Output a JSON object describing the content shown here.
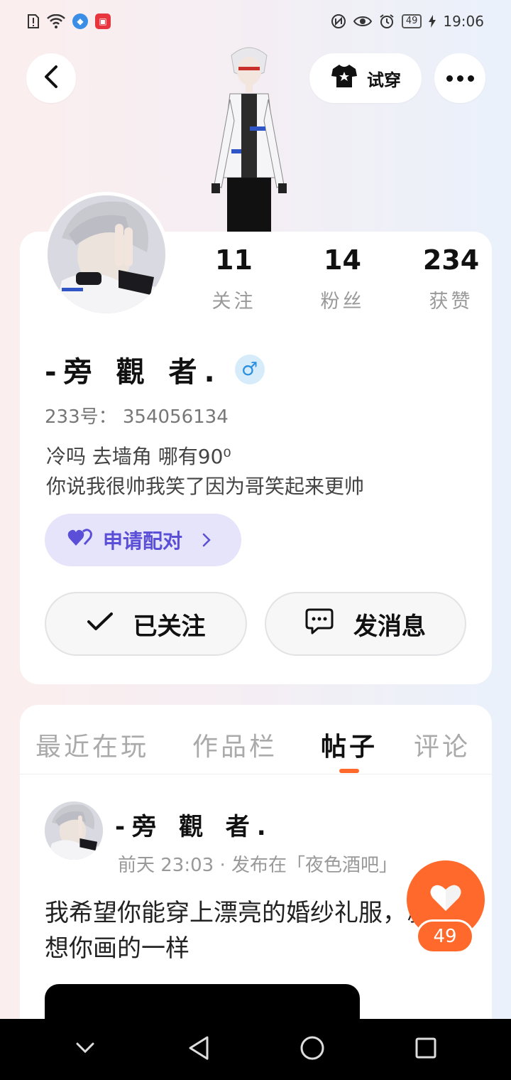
{
  "status_bar": {
    "time": "19:06",
    "battery": "49",
    "left_icons": [
      "sim-alert-icon",
      "wifi-icon",
      "browser-app-icon",
      "video-app-icon"
    ],
    "right_icons": [
      "nfc-icon",
      "eye-comfort-icon",
      "alarm-icon",
      "battery-icon",
      "charging-icon"
    ]
  },
  "header": {
    "try_on_label": "试穿"
  },
  "profile": {
    "stats": [
      {
        "value": "11",
        "label": "关注"
      },
      {
        "value": "14",
        "label": "粉丝"
      },
      {
        "value": "234",
        "label": "获赞"
      }
    ],
    "name": "-旁 觀 者.",
    "gender_symbol": "♂",
    "uid": "233号： 354056134",
    "bio_line1": "冷吗 去墙角 哪有90⁰",
    "bio_line2": "你说我很帅我笑了因为哥笑起来更帅",
    "pair_label": "申请配对",
    "follow_label": "已关注",
    "message_label": "发消息"
  },
  "tabs": [
    {
      "label": "最近在玩",
      "active": false
    },
    {
      "label": "作品栏",
      "active": false
    },
    {
      "label": "帖子",
      "active": true
    },
    {
      "label": "评论",
      "active": false
    }
  ],
  "post": {
    "author": "-旁 觀 者.",
    "meta": "前天 23:03 · 发布在「夜色酒吧」",
    "text": "我希望你能穿上漂亮的婚纱礼服，就想你画的一样"
  },
  "like": {
    "count": "49"
  },
  "colors": {
    "accent_orange": "#ff6a2c",
    "pair_purple": "#5a4fd6",
    "pair_bg": "#e6e4fa",
    "gender_blue": "#2b8fe0"
  }
}
